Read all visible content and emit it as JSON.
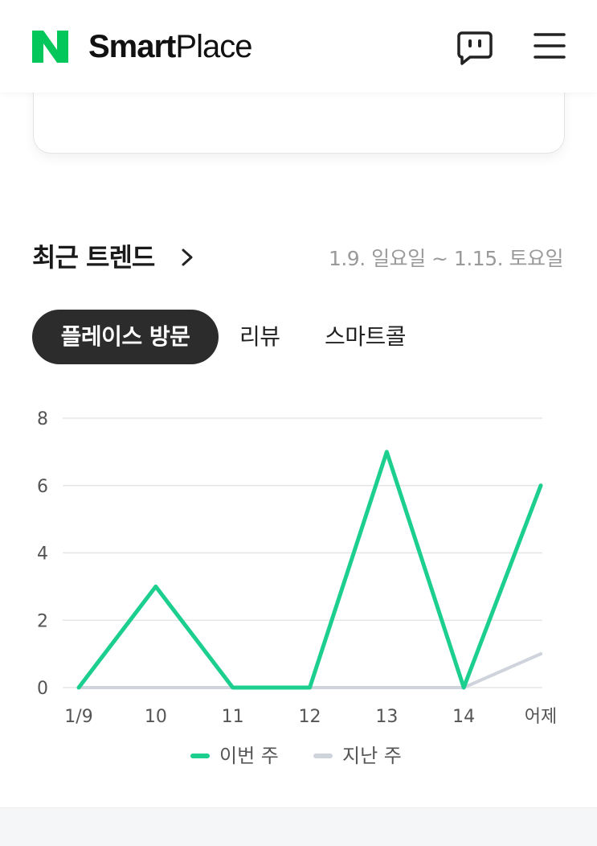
{
  "header": {
    "logo_letter": "N",
    "brand_bold": "Smart",
    "brand_regular": "Place",
    "chat_icon": "chat-bubble-icon",
    "menu_icon": "hamburger-menu-icon"
  },
  "trend": {
    "title": "최근 트렌드",
    "date_range": "1.9. 일요일 ~ 1.15. 토요일",
    "tabs": [
      {
        "label": "플레이스 방문",
        "active": true
      },
      {
        "label": "리뷰",
        "active": false
      },
      {
        "label": "스마트콜",
        "active": false
      }
    ]
  },
  "colors": {
    "accent": "#1ccf8f",
    "last_week": "#cfd3dc",
    "logo_green": "#03c75a",
    "tab_active_bg": "#2c2c2c"
  },
  "chart_data": {
    "type": "line",
    "categories": [
      "1/9",
      "10",
      "11",
      "12",
      "13",
      "14",
      "어제"
    ],
    "series": [
      {
        "name": "이번 주",
        "values": [
          0,
          3,
          0,
          0,
          7,
          0,
          6
        ]
      },
      {
        "name": "지난 주",
        "values": [
          0,
          0,
          0,
          0,
          0,
          0,
          1
        ]
      }
    ],
    "yticks": [
      0,
      2,
      4,
      6,
      8
    ],
    "ylim": [
      0,
      8
    ],
    "grid": true,
    "legend_position": "bottom"
  }
}
